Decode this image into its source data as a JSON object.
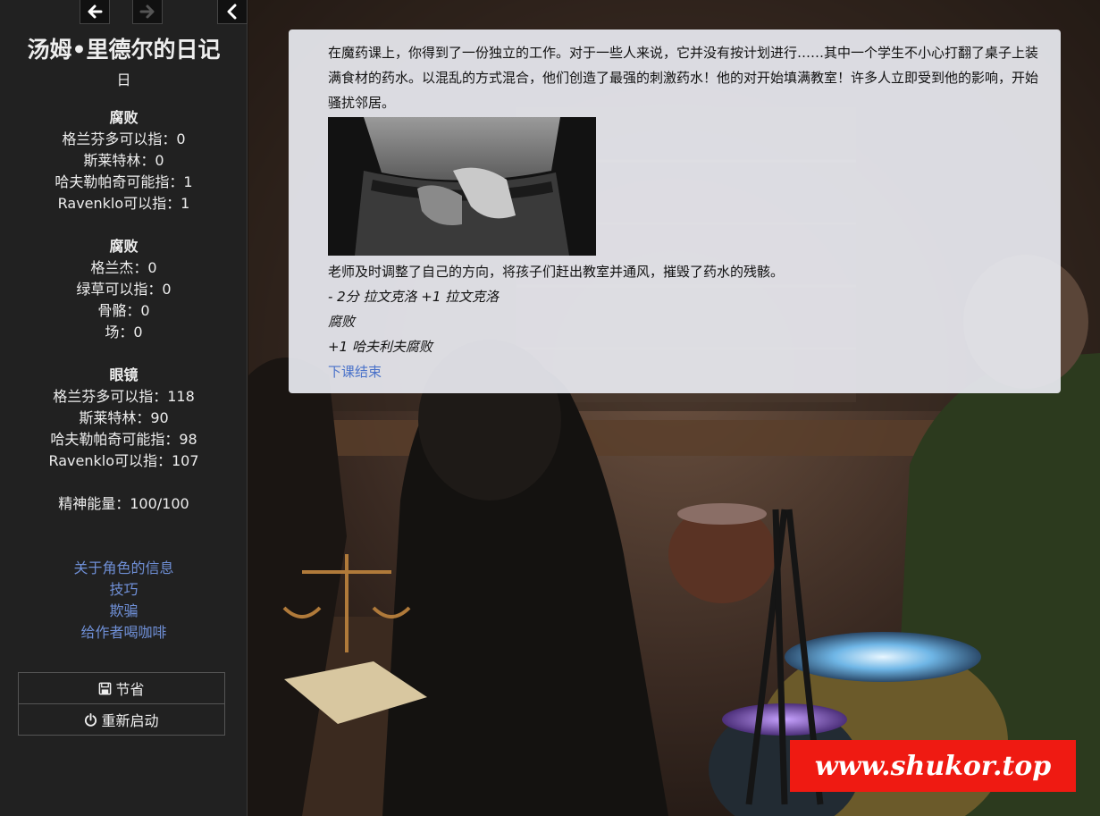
{
  "nav": {
    "back_icon": "arrow-left-icon",
    "forward_icon": "arrow-right-icon",
    "collapse_icon": "chevron-left-icon"
  },
  "sidebar": {
    "title": "汤姆•里德尔的日记",
    "day": "日",
    "stats": [
      {
        "header": "腐败",
        "lines": [
          "格兰芬多可以指：0",
          "斯莱特林：0",
          "哈夫勒帕奇可能指：1",
          "Ravenklo可以指：1"
        ]
      },
      {
        "header": "腐败",
        "lines": [
          "格兰杰：0",
          "绿草可以指：0",
          "骨骼：0",
          "场：0"
        ]
      },
      {
        "header": "眼镜",
        "lines": [
          "格兰芬多可以指：118",
          "斯莱特林：90",
          "哈夫勒帕奇可能指：98",
          "Ravenklo可以指：107"
        ]
      }
    ],
    "energy": "精神能量：100/100",
    "links": [
      "关于角色的信息",
      "技巧",
      "欺骗",
      "给作者喝咖啡"
    ],
    "save_label": "节省",
    "save_icon": "floppy-disk-icon",
    "restart_label": "重新启动",
    "restart_icon": "power-icon"
  },
  "passage": {
    "para1": "在魔药课上，你得到了一份独立的工作。对于一些人来说，它并没有按计划进行……其中一个学生不小心打翻了桌子上装满食材的药水。以混乱的方式混合，他们创造了最强的刺激药水！他的对开始填满教室！许多人立即受到他的影响，开始骚扰邻居。",
    "para2": "老师及时调整了自己的方向，将孩子们赶出教室并通风，摧毁了药水的残骸。",
    "effect1": "- 2分 拉文克洛 +1 拉文克洛",
    "effect2": "腐败",
    "effect3": "+1 哈夫利夫腐败",
    "continue_link": "下课结束"
  },
  "watermark": "www.shukor.top",
  "colors": {
    "sidebar_bg": "#212121",
    "link": "#6f8fd6",
    "panel_bg": "#e8eaf0",
    "watermark_bg": "#ef1a12"
  }
}
